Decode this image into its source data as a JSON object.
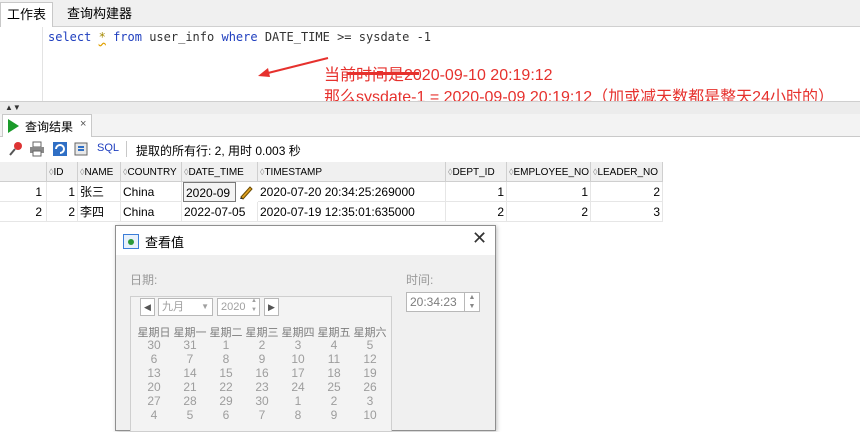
{
  "tabs": {
    "worksheet": "工作表",
    "query_builder": "查询构建器"
  },
  "sql": {
    "kw_select": "select",
    "star": "*",
    "kw_from": "from",
    "table": "user_info",
    "kw_where": "where",
    "condition": "DATE_TIME >=",
    "expr": "sysdate -1"
  },
  "annotation": {
    "line1": "当前时间是2020-09-10 20:19:12",
    "line2": "那么sysdate-1 = 2020-09-09 20:19:12（加或减天数都是整天24小时的）",
    "color": "#e6312d"
  },
  "results_tab": {
    "label": "查询结果",
    "close": "×"
  },
  "toolbar": {
    "sql_label": "SQL",
    "status": "提取的所有行: 2, 用时 0.003 秒",
    "icons": [
      "pin-icon",
      "print-icon",
      "refresh-icon",
      "sql-icon"
    ]
  },
  "grid": {
    "columns": [
      "ID",
      "NAME",
      "COUNTRY",
      "DATE_TIME",
      "TIMESTAMP",
      "DEPT_ID",
      "EMPLOYEE_NO",
      "LEADER_NO"
    ],
    "rows": [
      {
        "rowno": "1",
        "ID": "1",
        "NAME": "张三",
        "COUNTRY": "China",
        "DATE_TIME": "2020-09",
        "TIMESTAMP": "2020-07-20 20:34:25:269000",
        "DEPT_ID": "1",
        "EMPLOYEE_NO": "1",
        "LEADER_NO": "2"
      },
      {
        "rowno": "2",
        "ID": "2",
        "NAME": "李四",
        "COUNTRY": "China",
        "DATE_TIME": "2022-07-05",
        "TIMESTAMP": "2020-07-19 12:35:01:635000",
        "DEPT_ID": "2",
        "EMPLOYEE_NO": "2",
        "LEADER_NO": "3"
      }
    ]
  },
  "dialog": {
    "title": "查看值",
    "close": "✕",
    "date_label": "日期:",
    "time_label": "时间:",
    "month": "九月",
    "year": "2020",
    "time_value": "20:34:23",
    "weekdays": [
      "星期日",
      "星期一",
      "星期二",
      "星期三",
      "星期四",
      "星期五",
      "星期六"
    ],
    "weeks": [
      [
        "30",
        "31",
        "1",
        "2",
        "3",
        "4",
        "5"
      ],
      [
        "6",
        "7",
        "8",
        "9",
        "10",
        "11",
        "12"
      ],
      [
        "13",
        "14",
        "15",
        "16",
        "17",
        "18",
        "19"
      ],
      [
        "20",
        "21",
        "22",
        "23",
        "24",
        "25",
        "26"
      ],
      [
        "27",
        "28",
        "29",
        "30",
        "1",
        "2",
        "3"
      ],
      [
        "4",
        "5",
        "6",
        "7",
        "8",
        "9",
        "10"
      ]
    ]
  }
}
